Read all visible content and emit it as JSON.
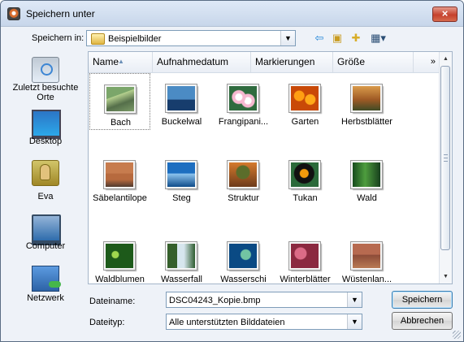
{
  "window": {
    "title": "Speichern unter",
    "close_label": "×"
  },
  "location": {
    "label": "Speichern in:",
    "value": "Beispielbilder",
    "toolbar_icons": [
      "back-arrow-icon",
      "up-folder-icon",
      "new-folder-icon",
      "view-menu-icon"
    ]
  },
  "places": [
    {
      "label": "Zuletzt besuchte Orte",
      "icon": "recent-places-icon"
    },
    {
      "label": "Desktop",
      "icon": "desktop-icon"
    },
    {
      "label": "Eva",
      "icon": "user-folder-icon"
    },
    {
      "label": "Computer",
      "icon": "computer-icon"
    },
    {
      "label": "Netzwerk",
      "icon": "network-icon"
    }
  ],
  "columns": [
    "Name",
    "Aufnahmedatum",
    "Markierungen",
    "Größe"
  ],
  "more_columns_label": "»",
  "files": [
    {
      "name": "Bach"
    },
    {
      "name": "Buckelwal"
    },
    {
      "name": "Frangipani..."
    },
    {
      "name": "Garten"
    },
    {
      "name": "Herbstblätter"
    },
    {
      "name": "Säbelantilope"
    },
    {
      "name": "Steg"
    },
    {
      "name": "Struktur"
    },
    {
      "name": "Tukan"
    },
    {
      "name": "Wald"
    },
    {
      "name": "Waldblumen"
    },
    {
      "name": "Wasserfall"
    },
    {
      "name": "Wasserschi"
    },
    {
      "name": "Winterblätter"
    },
    {
      "name": "Wüstenlan..."
    }
  ],
  "filename": {
    "label": "Dateiname:",
    "value": "DSC04243_Kopie.bmp"
  },
  "filetype": {
    "label": "Dateityp:",
    "value": "Alle unterstützten Bilddateien"
  },
  "buttons": {
    "save": "Speichern",
    "cancel": "Abbrechen"
  }
}
